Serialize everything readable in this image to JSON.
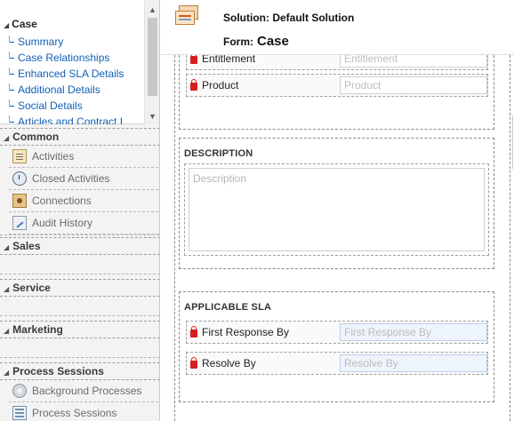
{
  "nav": {
    "case_title": "Case",
    "case_links": [
      "Summary",
      "Case Relationships",
      "Enhanced SLA Details",
      "Additional Details",
      "Social Details",
      "Articles and Contract I"
    ],
    "groups": {
      "common": {
        "title": "Common",
        "items": [
          {
            "label": "Activities",
            "icon": "activities-icon"
          },
          {
            "label": "Closed Activities",
            "icon": "closed-activities-icon"
          },
          {
            "label": "Connections",
            "icon": "connections-icon"
          },
          {
            "label": "Audit History",
            "icon": "audit-history-icon"
          }
        ]
      },
      "sales": {
        "title": "Sales"
      },
      "service": {
        "title": "Service"
      },
      "marketing": {
        "title": "Marketing"
      },
      "process_sessions": {
        "title": "Process Sessions",
        "items": [
          {
            "label": "Background Processes",
            "icon": "background-processes-icon"
          },
          {
            "label": "Process Sessions",
            "icon": "process-sessions-icon"
          }
        ]
      }
    }
  },
  "header": {
    "solution_label": "Solution: Default Solution",
    "form_prefix": "Form:",
    "form_name": "Case"
  },
  "form": {
    "entitlement": {
      "label": "Entitlement",
      "placeholder": "Entitlement"
    },
    "product": {
      "label": "Product",
      "placeholder": "Product"
    },
    "description": {
      "title": "DESCRIPTION",
      "placeholder": "Description"
    },
    "applicable_sla": {
      "title": "APPLICABLE SLA",
      "first_response": {
        "label": "First Response By",
        "placeholder": "First Response By"
      },
      "resolve_by": {
        "label": "Resolve By",
        "placeholder": "Resolve By"
      }
    }
  },
  "colors": {
    "link": "#1160b7",
    "lock": "#d61e1e",
    "sla_input_bg": "#eef4fb"
  }
}
